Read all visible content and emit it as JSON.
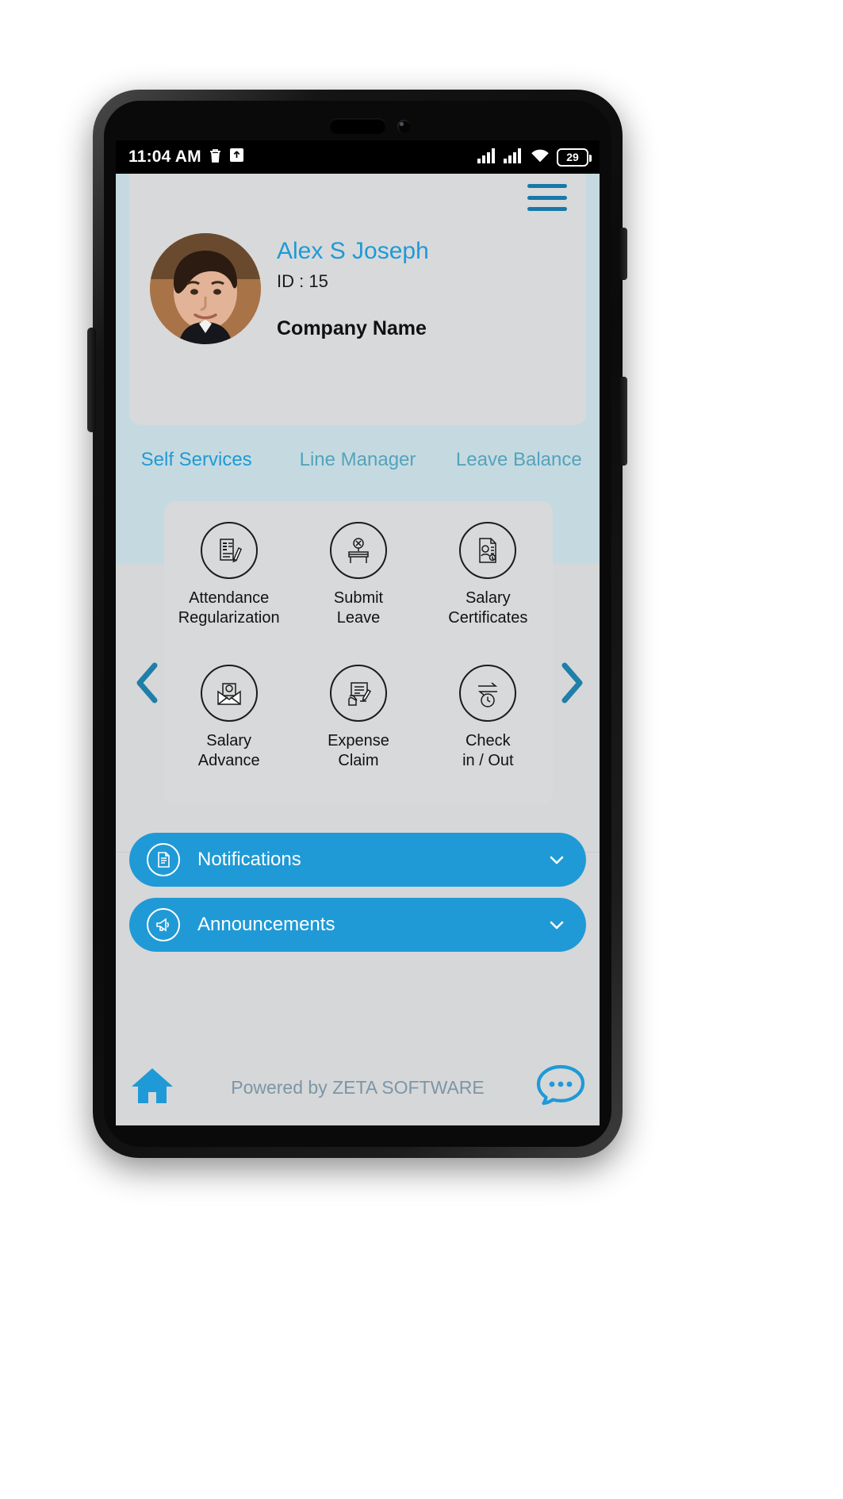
{
  "statusbar": {
    "time": "11:04 AM",
    "left_icons": [
      "trash-icon",
      "upload-icon"
    ],
    "right_icons": [
      "signal-bars-icon",
      "signal-bars-icon",
      "wifi-icon"
    ],
    "battery_level": "29"
  },
  "header": {
    "menu_icon": "hamburger-menu-icon",
    "avatar_alt": "user-profile-photo",
    "name": "Alex S Joseph",
    "id_label": "ID : 15",
    "company": "Company Name",
    "name_color": "#1f9ad6"
  },
  "tabs": [
    {
      "label": "Self Services",
      "active": true
    },
    {
      "label": "Line Manager",
      "active": false
    },
    {
      "label": "Leave Balance",
      "active": false
    }
  ],
  "services": [
    {
      "label": "Attendance\nRegularization",
      "line1": "Attendance",
      "line2": "Regularization",
      "icon": "document-pen-icon"
    },
    {
      "label": "Submit\nLeave",
      "line1": "Submit",
      "line2": "Leave",
      "icon": "desk-absent-icon"
    },
    {
      "label": "Salary\nCertificates",
      "line1": "Salary",
      "line2": "Certificates",
      "icon": "certificate-icon"
    },
    {
      "label": "Salary\nAdvance",
      "line1": "Salary",
      "line2": "Advance",
      "icon": "money-envelope-icon"
    },
    {
      "label": "Expense\nClaim",
      "line1": "Expense",
      "line2": "Claim",
      "icon": "receipt-hand-icon"
    },
    {
      "label": "Check\nin / Out",
      "line1": "Check",
      "line2": "in / Out",
      "icon": "clock-swap-icon"
    }
  ],
  "carousel": {
    "prev_icon": "chevron-left-icon",
    "next_icon": "chevron-right-icon"
  },
  "panels": [
    {
      "label": "Notifications",
      "icon": "notification-doc-icon",
      "chevron": "chevron-down-icon",
      "color": "#1f9ad6"
    },
    {
      "label": "Announcements",
      "icon": "megaphone-icon",
      "chevron": "chevron-down-icon",
      "color": "#1f9ad6"
    }
  ],
  "footer": {
    "home_icon": "home-icon",
    "powered_by": "Powered by ZETA SOFTWARE",
    "chat_icon": "chat-bubble-icon",
    "text_color": "#7b96a5"
  }
}
